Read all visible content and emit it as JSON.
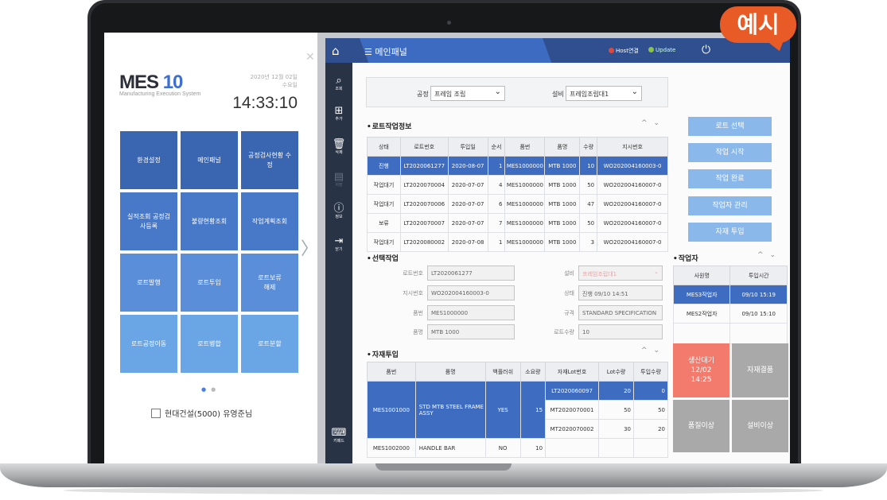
{
  "badge": "예시",
  "left_panel": {
    "logo_main": "MES",
    "logo_num": "10",
    "logo_sub": "Manufacturing Execution System",
    "date": "2020년 12월 02일",
    "weekday": "수요일",
    "time": "14:33:10",
    "tiles": [
      "환경설정",
      "메인패널",
      "공정검사현황 수정",
      "실적조회 공정검사등록",
      "불량현황조회",
      "작업계획조회",
      "로트발행",
      "로트투입",
      "로트보류 해제",
      "로트공정이동",
      "로트병합",
      "로트분할"
    ],
    "company": "현대건설(5000) 유영준님"
  },
  "titlebar": {
    "title": "메인패널",
    "host": "Host연결",
    "update": "Update"
  },
  "sidebar": [
    {
      "icon": "⌕",
      "label": "조회"
    },
    {
      "icon": "⊞",
      "label": "추가"
    },
    {
      "icon": "🗑",
      "label": "삭제"
    },
    {
      "icon": "▤",
      "label": "저장"
    },
    {
      "icon": "ⓘ",
      "label": "정보"
    },
    {
      "icon": "⇥",
      "label": "닫기"
    },
    {
      "icon": "⌨",
      "label": "키패드"
    }
  ],
  "filter": {
    "process_label": "공정",
    "process_value": "프레임 조립",
    "equip_label": "설비",
    "equip_value": "프레임조립대1"
  },
  "lot_info": {
    "title": "로트작업정보",
    "headers": [
      "상태",
      "로트번호",
      "투입일",
      "순서",
      "품번",
      "품명",
      "수량",
      "지시번호"
    ],
    "rows": [
      [
        "진행",
        "LT2020061277",
        "2020-08-07",
        "1",
        "MES1000000",
        "MTB 1000",
        "10",
        "WO202004160003-0"
      ],
      [
        "작업대기",
        "LT2020070004",
        "2020-07-07",
        "4",
        "MES1000000",
        "MTB 1000",
        "50",
        "WO202004160007-0"
      ],
      [
        "작업대기",
        "LT2020070006",
        "2020-07-07",
        "6",
        "MES1000000",
        "MTB 1000",
        "47",
        "WO202004160007-0"
      ],
      [
        "보류",
        "LT2020070007",
        "2020-07-07",
        "7",
        "MES1000000",
        "MTB 1000",
        "50",
        "WO202004160007-0"
      ],
      [
        "작업대기",
        "LT2020080002",
        "2020-07-08",
        "1",
        "MES1000000",
        "MTB 1000",
        "3",
        "WO202004160007-0"
      ]
    ]
  },
  "right_buttons": [
    "로트 선택",
    "작업 시작",
    "작업 완료",
    "작업자 관리",
    "자재 투입"
  ],
  "selected": {
    "title": "선택작업",
    "lot_label": "로트번호",
    "lot": "LT2020061277",
    "order_label": "지시번호",
    "order": "WO202004160003-0",
    "part_label": "품번",
    "part": "MES1000000",
    "name_label": "품명",
    "name": "MTB 1000",
    "equip_label": "설비",
    "equip": "프레임조립대1",
    "status_label": "상태",
    "status": "진행 09/10 14:51",
    "spec_label": "규격",
    "spec": "STANDARD SPECIFICATION",
    "qty_label": "로트수량",
    "qty": "10"
  },
  "workers": {
    "title": "작업자",
    "headers": [
      "사원명",
      "투입시간"
    ],
    "rows": [
      [
        "MES3작업자",
        "09/10 15:19"
      ],
      [
        "MES2작업자",
        "09/10 15:10"
      ]
    ]
  },
  "material": {
    "title": "자재투입",
    "headers": [
      "품번",
      "품명",
      "백플러쉬",
      "소요량",
      "자재Lot번호",
      "Lot수량",
      "투입수량"
    ],
    "group1": {
      "part": "MES1001000",
      "name": "STD MTB STEEL FRAME ASSY",
      "backflush": "YES",
      "req": "15",
      "lots": [
        [
          "LT2020060097",
          "20",
          "0"
        ],
        [
          "MT2020070001",
          "50",
          "50"
        ],
        [
          "MT2020070002",
          "30",
          "20"
        ]
      ]
    },
    "row2": [
      "MES1002000",
      "HANDLE BAR",
      "NO",
      "10"
    ]
  },
  "status_buttons": {
    "prod": "생산대기",
    "prod_date": "12/02",
    "prod_time": "14:25",
    "mat": "자재결품",
    "qual": "품질이상",
    "equip": "설비이상"
  },
  "colors": {
    "accent": "#3d6cc0",
    "prod": "#f37b6e",
    "gray": "#a9a9a9"
  }
}
